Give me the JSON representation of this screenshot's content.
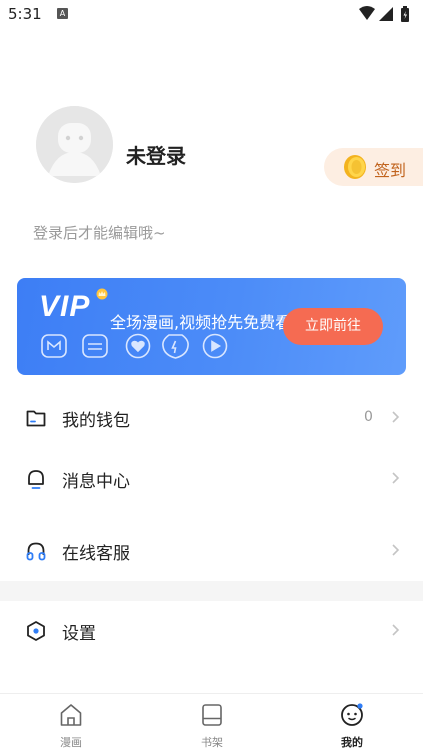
{
  "status_bar": {
    "time": "5:31",
    "notification_badge": "A",
    "icons": [
      "wifi-icon",
      "signal-icon",
      "battery-icon"
    ]
  },
  "profile": {
    "username": "未登录",
    "bio": "登录后才能编辑哦~",
    "checkin_label": "签到"
  },
  "vip_banner": {
    "logo": "VIP",
    "text": "全场漫画,视频抢先免费看",
    "button_label": "立即前往",
    "colors": {
      "background": "#4c8cf8",
      "button": "#f56b52"
    }
  },
  "menu": [
    {
      "label": "我的钱包",
      "value": "0",
      "icon": "wallet-icon"
    },
    {
      "label": "消息中心",
      "value": "",
      "icon": "bell-icon"
    },
    {
      "label": "在线客服",
      "value": "",
      "icon": "headset-icon"
    },
    {
      "label": "设置",
      "value": "",
      "icon": "settings-icon"
    }
  ],
  "bottom_nav": [
    {
      "label": "漫画",
      "icon": "home-icon",
      "active": false
    },
    {
      "label": "书架",
      "icon": "bookshelf-icon",
      "active": false
    },
    {
      "label": "我的",
      "icon": "profile-icon",
      "active": true
    }
  ]
}
